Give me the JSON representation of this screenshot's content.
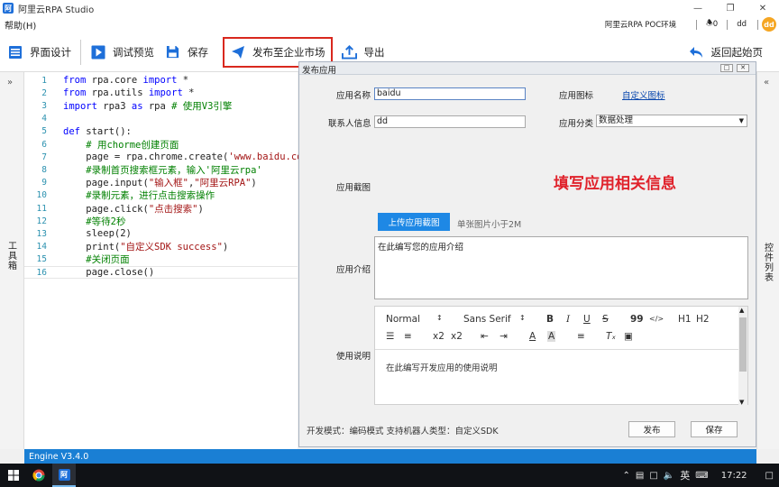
{
  "app": {
    "logo": "阿",
    "title": "阿里云RPA Studio"
  },
  "window": {
    "min_icon": "minimize-icon",
    "max_icon": "maximize-icon",
    "close_icon": "close-icon"
  },
  "menu": {
    "help": "帮助(H)",
    "env": "阿里云RPA POC环境",
    "notifications": "0",
    "user": "dd",
    "avatar": "dd"
  },
  "toolbar": {
    "ui_design": "界面设计",
    "debug_preview": "调试预览",
    "save": "保存",
    "publish_market": "发布至企业市场",
    "export": "导出",
    "back_home": "返回起始页"
  },
  "colors": {
    "accent": "#1a7fd4",
    "highlight_border": "#d9281e",
    "annotation": "#e0222b",
    "link": "#0645ad"
  },
  "left_panel": {
    "toggle": "»",
    "label": "工具箱"
  },
  "right_panel": {
    "toggle": "«",
    "label": "控件列表"
  },
  "editor": {
    "lines": [
      {
        "n": "1",
        "parts": [
          [
            "kw",
            "from"
          ],
          [
            "",
            " rpa.core "
          ],
          [
            "kw",
            "import"
          ],
          [
            "",
            " *"
          ]
        ]
      },
      {
        "n": "2",
        "parts": [
          [
            "kw",
            "from"
          ],
          [
            "",
            " rpa.utils "
          ],
          [
            "kw",
            "import"
          ],
          [
            "",
            " *"
          ]
        ]
      },
      {
        "n": "3",
        "parts": [
          [
            "kw",
            "import"
          ],
          [
            "",
            " rpa3 "
          ],
          [
            "kw",
            "as"
          ],
          [
            "",
            " rpa "
          ],
          [
            "cm",
            "# 使用V3引擎"
          ]
        ]
      },
      {
        "n": "4",
        "parts": []
      },
      {
        "n": "5",
        "parts": [
          [
            "kw",
            "def"
          ],
          [
            "",
            " start():"
          ]
        ]
      },
      {
        "n": "6",
        "parts": [
          [
            "",
            "    "
          ],
          [
            "cm",
            "# 用chorme创建页面"
          ]
        ]
      },
      {
        "n": "7",
        "parts": [
          [
            "",
            "    page = rpa.chrome.create("
          ],
          [
            "st",
            "'www.baidu.com'"
          ],
          [
            "",
            ")"
          ]
        ]
      },
      {
        "n": "8",
        "parts": [
          [
            "",
            "    "
          ],
          [
            "cm",
            "#录制首页搜索框元素，输入'阿里云rpa'"
          ]
        ]
      },
      {
        "n": "9",
        "parts": [
          [
            "",
            "    page.input("
          ],
          [
            "st",
            "\"输入框\""
          ],
          [
            "",
            ","
          ],
          [
            "st",
            "\"阿里云RPA\""
          ],
          [
            "",
            ")"
          ]
        ]
      },
      {
        "n": "10",
        "parts": [
          [
            "",
            "    "
          ],
          [
            "cm",
            "#录制元素，进行点击搜索操作"
          ]
        ]
      },
      {
        "n": "11",
        "parts": [
          [
            "",
            "    page.click("
          ],
          [
            "st",
            "\"点击搜索\""
          ],
          [
            "",
            ")"
          ]
        ]
      },
      {
        "n": "12",
        "parts": [
          [
            "",
            "    "
          ],
          [
            "cm",
            "#等待2秒"
          ]
        ]
      },
      {
        "n": "13",
        "parts": [
          [
            "",
            "    sleep(2)"
          ]
        ]
      },
      {
        "n": "14",
        "parts": [
          [
            "",
            "    print("
          ],
          [
            "st",
            "\"自定义SDK success\""
          ],
          [
            "",
            ")"
          ]
        ]
      },
      {
        "n": "15",
        "parts": [
          [
            "",
            "    "
          ],
          [
            "cm",
            "#关闭页面"
          ]
        ]
      },
      {
        "n": "16",
        "parts": [
          [
            "",
            "    page.close()"
          ]
        ]
      }
    ]
  },
  "dialog": {
    "title": "发布应用",
    "app_name_label": "应用名称",
    "app_name_value": "baidu",
    "app_icon_label": "应用图标",
    "custom_icon_link": "自定义图标",
    "contact_label": "联系人信息",
    "contact_value": "dd",
    "category_label": "应用分类",
    "category_value": "数据处理",
    "screenshot_label": "应用截图",
    "annotation": "填写应用相关信息",
    "upload_button": "上传应用截图",
    "upload_hint": "单张图片小于2M",
    "intro_label": "应用介绍",
    "intro_placeholder": "在此编写您的应用介绍",
    "usage_label": "使用说明",
    "usage_placeholder": "在此编写开发应用的使用说明",
    "rte": {
      "format": "Normal",
      "font": "Sans Serif",
      "bold": "B",
      "italic": "I",
      "underline": "U",
      "strike": "S",
      "quote": "99",
      "code": "</>",
      "h1": "H1",
      "h2": "H2",
      "sub": "x2",
      "sup": "x2"
    },
    "footer_info": "开发模式：编码模式   支持机器人类型：自定义SDK",
    "publish_button": "发布",
    "save_button": "保存"
  },
  "statusbar": {
    "engine": "Engine V3.4.0"
  },
  "taskbar": {
    "ime": "英",
    "time": "17:22"
  }
}
